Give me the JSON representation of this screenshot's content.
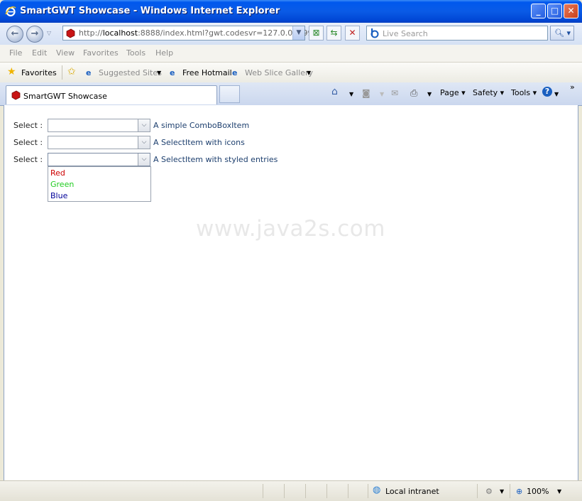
{
  "window": {
    "title": "SmartGWT Showcase - Windows Internet Explorer"
  },
  "nav": {
    "address_prefix": "http://",
    "address_host": "localhost",
    "address_rest": ":8888/index.html?gwt.codesvr=127.0.0.1:999",
    "search_placeholder": "Live Search"
  },
  "menubar": [
    "File",
    "Edit",
    "View",
    "Favorites",
    "Tools",
    "Help"
  ],
  "favbar": {
    "favorites": "Favorites",
    "suggested": "Suggested Sites",
    "hotmail": "Free Hotmail",
    "webslice": "Web Slice Gallery"
  },
  "tabs": {
    "active": "SmartGWT Showcase"
  },
  "tools": {
    "page": "Page",
    "safety": "Safety",
    "tools": "Tools"
  },
  "form": {
    "rows": [
      {
        "label": "Select :",
        "hint": "A simple ComboBoxItem"
      },
      {
        "label": "Select :",
        "hint": "A SelectItem with icons"
      },
      {
        "label": "Select :",
        "hint": "A SelectItem with styled entries"
      }
    ],
    "options": [
      {
        "text": "Red",
        "color": "#cc0000"
      },
      {
        "text": "Green",
        "color": "#22cc22"
      },
      {
        "text": "Blue",
        "color": "#000099"
      }
    ]
  },
  "watermark": "www.java2s.com",
  "status": {
    "zone": "Local intranet",
    "zoom": "100%"
  }
}
